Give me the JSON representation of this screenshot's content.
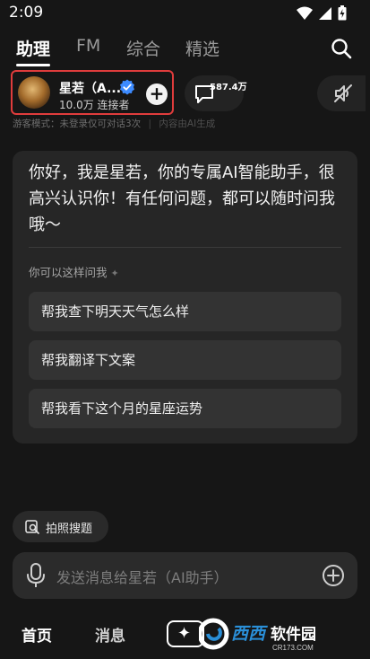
{
  "status_bar": {
    "time": "2:09"
  },
  "top_tabs": {
    "items": [
      "助理",
      "FM",
      "综合",
      "精选"
    ],
    "active": "助理"
  },
  "assistant": {
    "name": "星若（A...",
    "subtitle": "10.0万 连接者",
    "comment_count": "587.4万"
  },
  "guest_note": "游客模式：未登录仅可对话3次",
  "ai_note": "内容由AI生成",
  "chat": {
    "greeting": "你好，我是星若，你的专属AI智能助手，很高兴认识你！有任何问题，都可以随时问我哦～",
    "suggest_title": "你可以这样问我",
    "suggestions": [
      "帮我查下明天天气怎么样",
      "帮我翻译下文案",
      "帮我看下这个月的星座运势"
    ]
  },
  "photo_search": {
    "label": "拍照搜题"
  },
  "input": {
    "placeholder": "发送消息给星若（AI助手）"
  },
  "bottom_nav": {
    "home": "首页",
    "messages": "消息"
  },
  "watermark": {
    "brand": "西西软件园",
    "url": "CR173.COM"
  },
  "colors": {
    "background": "#161616",
    "card": "#262626",
    "highlight_border": "#e03c3c",
    "verified": "#3d8bff"
  }
}
